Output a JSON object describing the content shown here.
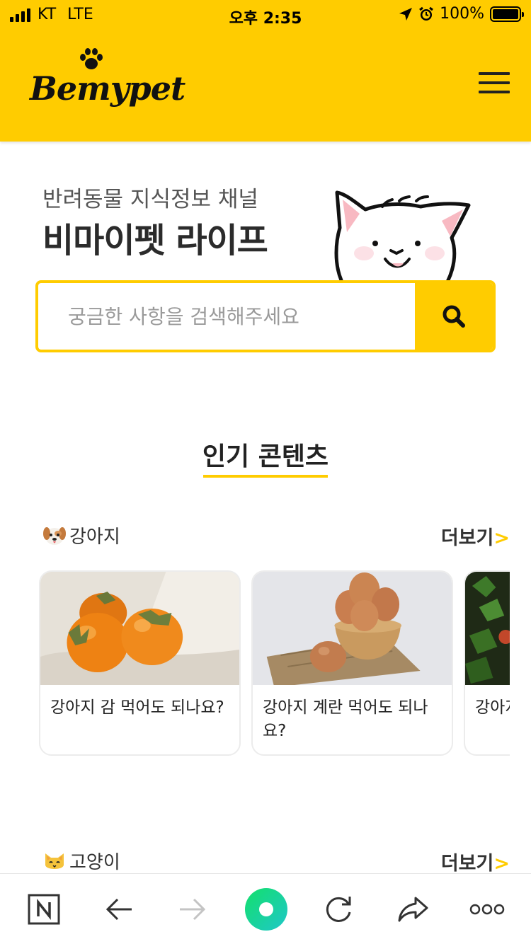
{
  "status_bar": {
    "carrier": "KT",
    "network": "LTE",
    "time": "오후 2:35",
    "battery": "100%",
    "battery_level": 1.0
  },
  "header": {
    "logo_text": "Bemypet",
    "menu_icon": "hamburger-menu-icon"
  },
  "hero": {
    "subtitle": "반려동물 지식정보 채널",
    "title": "비마이펫 라이프",
    "illustration": "cat-illustration"
  },
  "search": {
    "placeholder": "궁금한 사항을 검색해주세요",
    "button_icon": "search-icon"
  },
  "popular": {
    "title": "인기 콘텐츠",
    "categories": [
      {
        "label": "강아지",
        "icon": "dog-face-icon",
        "more_label": "더보기",
        "more_arrow": ">",
        "cards": [
          {
            "title": "강아지 감 먹어도 되나요?",
            "image": "persimmon-photo"
          },
          {
            "title": "강아지 계란 먹어도 되나요?",
            "image": "eggs-bowl-photo"
          },
          {
            "title": "강아지 …까?",
            "image": "parsley-photo"
          }
        ]
      },
      {
        "label": "고양이",
        "icon": "cat-face-icon",
        "more_label": "더보기",
        "more_arrow": ">"
      }
    ]
  },
  "browser_bar": {
    "items": [
      "naver-icon",
      "back-arrow-icon",
      "forward-arrow-icon",
      "green-dot-icon",
      "refresh-icon",
      "share-icon",
      "more-dots-icon"
    ]
  },
  "colors": {
    "brand_yellow": "#FFCC00",
    "text_dark": "#222222",
    "green_accent": "#1ED88E"
  }
}
